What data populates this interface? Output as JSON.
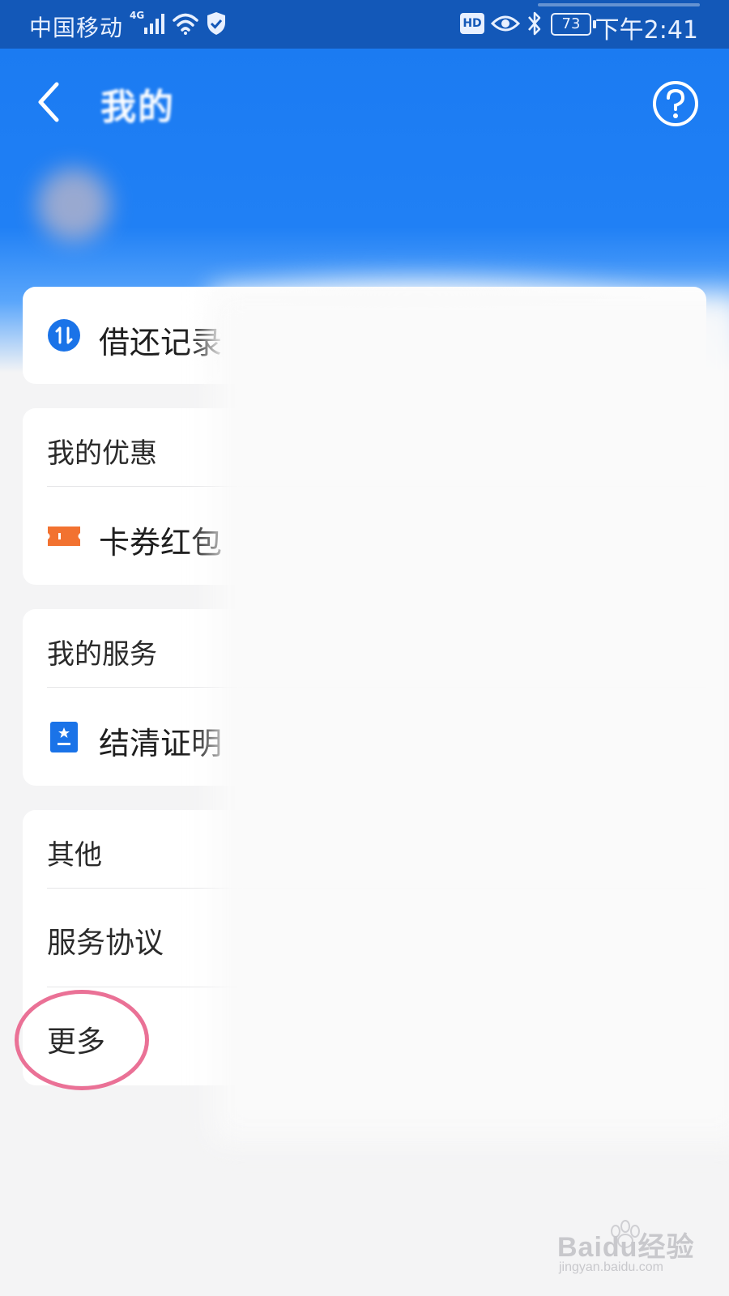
{
  "status_bar": {
    "carrier": "中国移动",
    "network_type": "4G",
    "hd_label": "HD",
    "battery": "73",
    "time": "下午2:41"
  },
  "header": {
    "title": "我的",
    "back_icon": "chevron-left-icon",
    "help_icon": "question-circle-icon"
  },
  "records_card": {
    "label": "借还记录",
    "icon": "transfer-arrows-icon",
    "icon_color": "#1a73e8"
  },
  "discounts_card": {
    "title": "我的优惠",
    "items": [
      {
        "label": "卡券红包",
        "icon": "coupon-ticket-icon",
        "icon_color": "#f27230"
      }
    ]
  },
  "services_card": {
    "title": "我的服务",
    "items": [
      {
        "label": "结清证明",
        "icon": "certificate-icon",
        "icon_color": "#1a73e8"
      }
    ]
  },
  "other_card": {
    "title": "其他",
    "items": [
      {
        "label": "服务协议"
      },
      {
        "label": "更多"
      }
    ]
  },
  "annotation": {
    "color": "#ea7196"
  },
  "watermark": {
    "brand": "Baidu经验",
    "url": "jingyan.baidu.com"
  },
  "colors": {
    "header_blue": "#1b7bf2",
    "status_bar": "#1358b8",
    "background": "#f4f4f5"
  }
}
